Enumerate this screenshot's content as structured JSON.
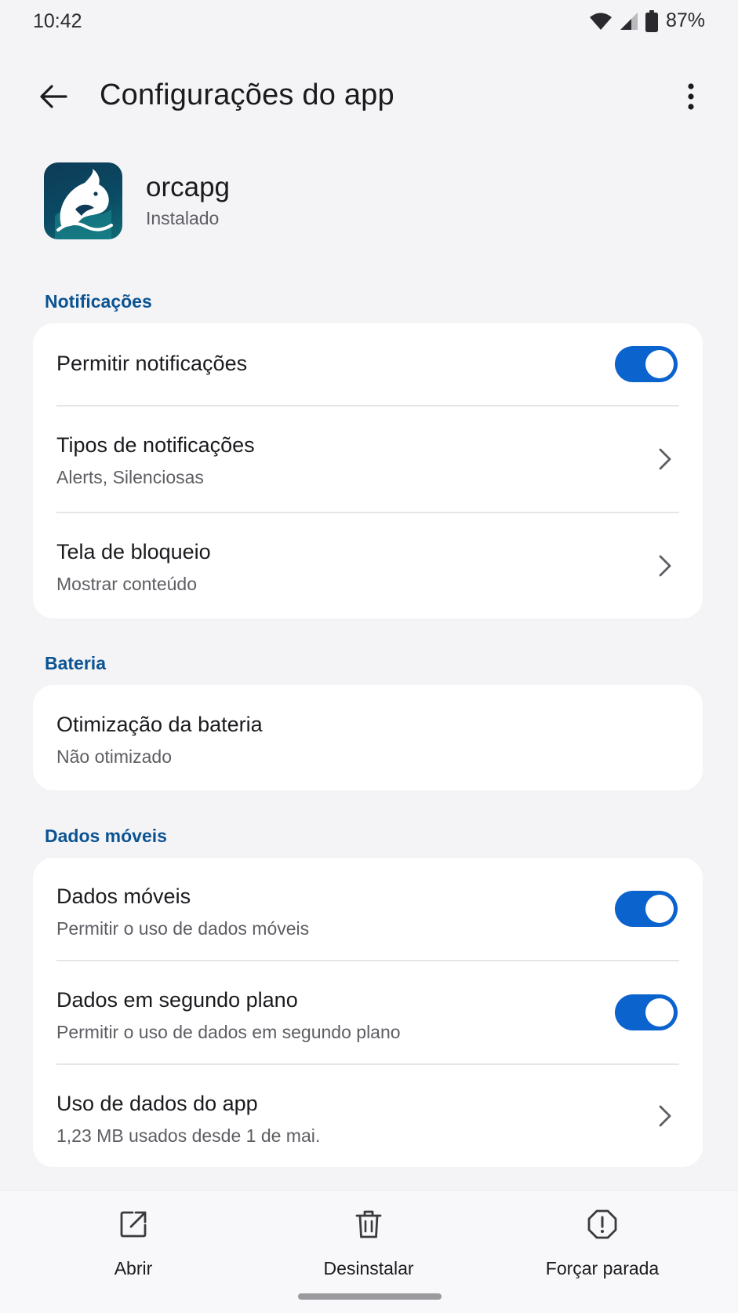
{
  "status_bar": {
    "time": "10:42",
    "battery": "87%"
  },
  "app_bar": {
    "title": "Configurações do app"
  },
  "app": {
    "name": "orcapg",
    "status": "Instalado"
  },
  "sections": {
    "notifications": {
      "label": "Notificações",
      "allow": {
        "label": "Permitir notificações",
        "enabled": true
      },
      "types": {
        "label": "Tipos de notificações",
        "value": "Alerts, Silenciosas"
      },
      "lock_screen": {
        "label": "Tela de bloqueio",
        "value": "Mostrar conteúdo"
      }
    },
    "battery": {
      "label": "Bateria",
      "optimization": {
        "label": "Otimização da bateria",
        "value": "Não otimizado"
      }
    },
    "mobile_data": {
      "label": "Dados móveis",
      "mobile": {
        "label": "Dados móveis",
        "value": "Permitir o uso de dados móveis",
        "enabled": true
      },
      "background": {
        "label": "Dados em segundo plano",
        "value": "Permitir o uso de dados em segundo plano",
        "enabled": true
      },
      "usage": {
        "label": "Uso de dados do app",
        "value": "1,23 MB usados desde 1 de mai."
      }
    }
  },
  "actions": {
    "open": "Abrir",
    "uninstall": "Desinstalar",
    "force_stop": "Forçar parada"
  },
  "colors": {
    "accent": "#0b63ce",
    "section_label": "#0b5393",
    "background": "#f4f4f6",
    "card": "#ffffff"
  },
  "icons": [
    "wifi-icon",
    "signal-icon",
    "battery-icon",
    "back-arrow-icon",
    "more-vert-icon",
    "orca-app-icon",
    "chevron-right-icon",
    "open-external-icon",
    "trash-icon",
    "alert-circle-icon"
  ]
}
